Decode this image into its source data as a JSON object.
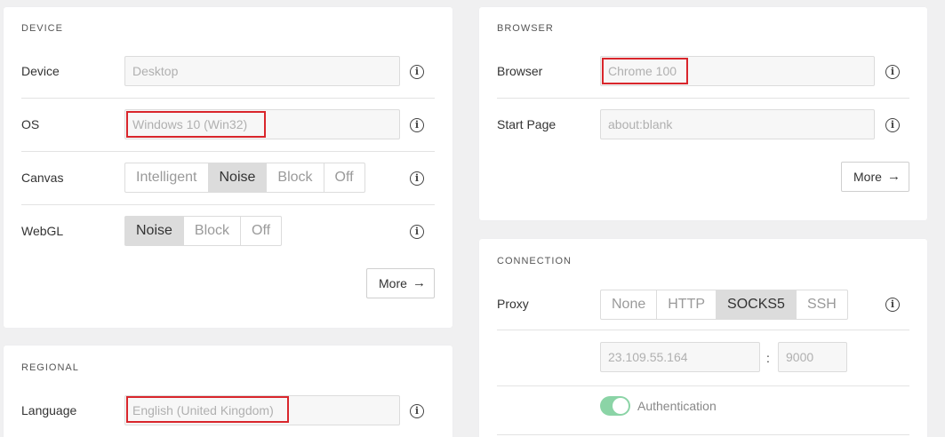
{
  "device_section": {
    "title": "DEVICE",
    "device": {
      "label": "Device",
      "value": "Desktop"
    },
    "os": {
      "label": "OS",
      "value": "Windows 10 (Win32)"
    },
    "canvas": {
      "label": "Canvas",
      "options": [
        "Intelligent",
        "Noise",
        "Block",
        "Off"
      ],
      "selected": "Noise"
    },
    "webgl": {
      "label": "WebGL",
      "options": [
        "Noise",
        "Block",
        "Off"
      ],
      "selected": "Noise"
    },
    "more_label": "More",
    "more_icon": "arrow-right-icon"
  },
  "regional_section": {
    "title": "REGIONAL",
    "language": {
      "label": "Language",
      "value": "English (United Kingdom)"
    }
  },
  "browser_section": {
    "title": "BROWSER",
    "browser": {
      "label": "Browser",
      "value": "Chrome 100"
    },
    "start_page": {
      "label": "Start Page",
      "value": "about:blank"
    },
    "more_label": "More",
    "more_icon": "arrow-right-icon"
  },
  "connection_section": {
    "title": "CONNECTION",
    "proxy": {
      "label": "Proxy",
      "options": [
        "None",
        "HTTP",
        "SOCKS5",
        "SSH"
      ],
      "selected": "SOCKS5"
    },
    "host": "23.109.55.164",
    "separator": ":",
    "port": "9000",
    "auth_label": "Authentication",
    "auth_enabled": true
  },
  "colors": {
    "highlight": "#d9262c",
    "toggle_on": "#8bd4a6",
    "active_segment": "#dcdcdc"
  },
  "icons": {
    "info": "info-icon"
  }
}
